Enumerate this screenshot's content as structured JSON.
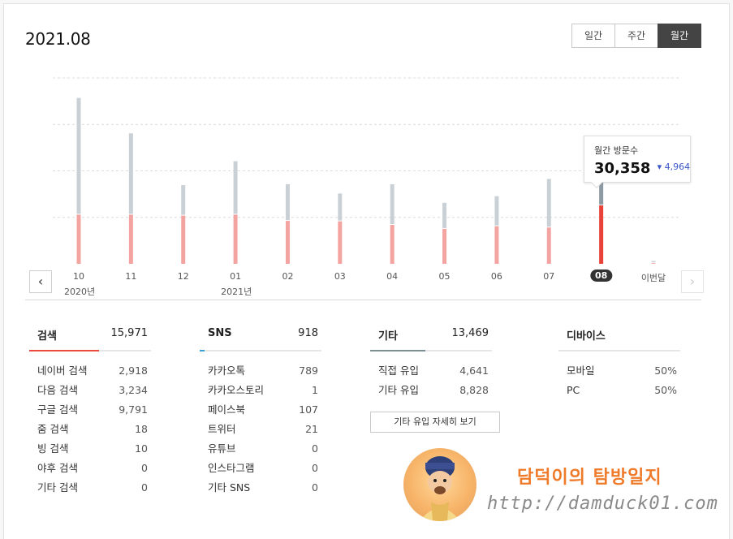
{
  "header": {
    "title": "2021.08",
    "period_tabs": [
      {
        "label": "일간",
        "active": false
      },
      {
        "label": "주간",
        "active": false
      },
      {
        "label": "월간",
        "active": true
      }
    ]
  },
  "chart_data": {
    "type": "bar",
    "categories": [
      "10",
      "11",
      "12",
      "01",
      "02",
      "03",
      "04",
      "05",
      "06",
      "07",
      "08",
      "이번달"
    ],
    "year_labels": [
      "2020년",
      "2021년"
    ],
    "selected_category": "08",
    "series": [
      {
        "values": [
          11100,
          11100,
          10900,
          11100,
          9700,
          9600,
          8800,
          7900,
          8500,
          8200,
          13200,
          150
        ],
        "color": "#f4a4a0"
      },
      {
        "values": [
          26200,
          18200,
          6700,
          11900,
          8100,
          6100,
          9000,
          5700,
          6600,
          10800,
          7000,
          300
        ],
        "color": "#c9d1d6"
      }
    ],
    "ylim": [
      0,
      42000
    ],
    "grid": true,
    "legend": false
  },
  "tooltip": {
    "label": "월간 방문수",
    "value": "30,358",
    "delta": "4,964",
    "delta_icon": "triangle-down-icon"
  },
  "nav": {
    "prev_icon": "chevron-left-icon",
    "next_icon": "chevron-right-icon"
  },
  "stats": [
    {
      "title": "검색",
      "total": "15,971",
      "bar_color": "#e84a3b",
      "bar_fraction": 0.57,
      "rows": [
        {
          "label": "네이버 검색",
          "value": "2,918"
        },
        {
          "label": "다음 검색",
          "value": "3,234"
        },
        {
          "label": "구글 검색",
          "value": "9,791"
        },
        {
          "label": "줌 검색",
          "value": "18"
        },
        {
          "label": "빙 검색",
          "value": "10"
        },
        {
          "label": "야후 검색",
          "value": "0"
        },
        {
          "label": "기타 검색",
          "value": "0"
        }
      ]
    },
    {
      "title": "SNS",
      "total": "918",
      "bar_color": "#3aa0d8",
      "bar_fraction": 0.04,
      "rows": [
        {
          "label": "카카오톡",
          "value": "789"
        },
        {
          "label": "카카오스토리",
          "value": "1"
        },
        {
          "label": "페이스북",
          "value": "107"
        },
        {
          "label": "트위터",
          "value": "21"
        },
        {
          "label": "유튜브",
          "value": "0"
        },
        {
          "label": "인스타그램",
          "value": "0"
        },
        {
          "label": "기타 SNS",
          "value": "0"
        }
      ]
    },
    {
      "title": "기타",
      "total": "13,469",
      "bar_color": "#7d8e96",
      "bar_fraction": 0.45,
      "rows": [
        {
          "label": "직접 유입",
          "value": "4,641"
        },
        {
          "label": "기타 유입",
          "value": "8,828"
        }
      ],
      "more_button": "기타 유입 자세히 보기"
    },
    {
      "title": "디바이스",
      "total": "",
      "bar_color": "#e6e6e6",
      "bar_fraction": 0,
      "rows": [
        {
          "label": "모바일",
          "value": "50%"
        },
        {
          "label": "PC",
          "value": "50%"
        }
      ]
    }
  ],
  "watermark": {
    "title": "담덕이의 탐방일지",
    "url": "http://damduck01.com"
  }
}
